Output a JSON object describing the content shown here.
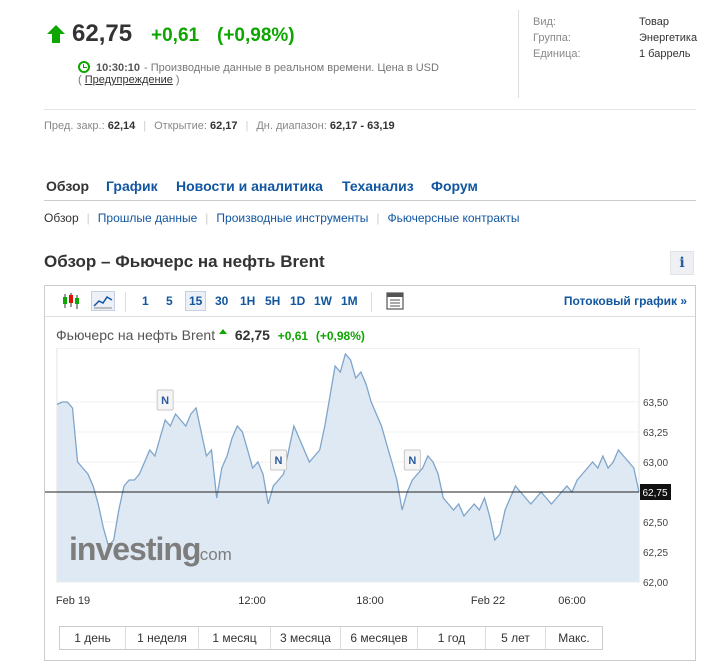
{
  "quote": {
    "price": "62,75",
    "change": "+0,61",
    "change_pct": "(+0,98%)",
    "time": "10:30:10",
    "time_note": "- Производные данные в реальном времени. Цена в USD",
    "disclaimer_open": "(",
    "disclaimer_link": "Предупреждение",
    "disclaimer_close": ")",
    "color_up": "#0ea600"
  },
  "info": {
    "rows": [
      {
        "label": "Вид:",
        "value": "Товар"
      },
      {
        "label": "Группа:",
        "value": "Энергетика"
      },
      {
        "label": "Единица:",
        "value": "1 баррель"
      }
    ]
  },
  "stats": {
    "prev_close_label": "Пред. закр.:",
    "prev_close": "62,14",
    "open_label": "Открытие:",
    "open": "62,17",
    "range_label": "Дн. диапазон:",
    "range": "62,17 - 63,19"
  },
  "nav": {
    "tabs": [
      "Обзор",
      "График",
      "Новости и аналитика",
      "Теханализ",
      "Форум"
    ],
    "subtabs": [
      "Обзор",
      "Прошлые данные",
      "Производные инструменты",
      "Фьючерсные контракты"
    ]
  },
  "section_title": "Обзор – Фьючерс на нефть Brent",
  "info_button": "i",
  "toolbar": {
    "intervals": [
      "1",
      "5",
      "15",
      "30",
      "1H",
      "5H",
      "1D",
      "1W",
      "1M"
    ],
    "active_interval": "15",
    "stream_label": "Потоковый график »"
  },
  "chart_header": {
    "name": "Фьючерс на нефть Brent",
    "price": "62,75",
    "change": "+0,61",
    "change_pct": "(+0,98%)"
  },
  "watermark": {
    "brand": "investing",
    "suffix": ".com"
  },
  "ranges": [
    "1 день",
    "1 неделя",
    "1 месяц",
    "3 месяца",
    "6 месяцев",
    "1 год",
    "5 лет",
    "Макс."
  ],
  "chart_data": {
    "type": "area",
    "title": "Фьючерс на нефть Brent",
    "x_ticks": [
      "Feb 19",
      "12:00",
      "18:00",
      "Feb 22",
      "06:00"
    ],
    "y_ticks": [
      "63,50",
      "63,25",
      "63,00",
      "62,50",
      "62,25",
      "62,00"
    ],
    "ylim": [
      62.0,
      63.95
    ],
    "current_price": 62.75,
    "current_label": "62,75",
    "news_markers": [
      "N",
      "N",
      "N"
    ],
    "series": [
      {
        "values": [
          63.48,
          63.5,
          63.5,
          63.45,
          63.0,
          62.95,
          62.9,
          62.8,
          62.65,
          62.45,
          62.3,
          62.35,
          62.6,
          62.8,
          62.85,
          62.85,
          62.9,
          63.0,
          63.1,
          63.05,
          63.2,
          63.35,
          63.3,
          63.4,
          63.35,
          63.3,
          63.4,
          63.45,
          63.25,
          63.05,
          63.1,
          62.7,
          62.95,
          63.05,
          63.2,
          63.3,
          63.25,
          63.1,
          62.95,
          63.0,
          62.9,
          62.65,
          62.8,
          62.85,
          62.9,
          63.1,
          63.3,
          63.2,
          63.1,
          63.0,
          63.05,
          63.1,
          63.3,
          63.55,
          63.8,
          63.75,
          63.9,
          63.85,
          63.7,
          63.75,
          63.65,
          63.5,
          63.4,
          63.3,
          63.15,
          63.0,
          62.85,
          62.6,
          62.75,
          62.85,
          62.9,
          62.95,
          63.05,
          63.0,
          62.9,
          62.7,
          62.65,
          62.6,
          62.65,
          62.55,
          62.6,
          62.65,
          62.6,
          62.7,
          62.55,
          62.35,
          62.4,
          62.6,
          62.7,
          62.8,
          62.75,
          62.7,
          62.65,
          62.7,
          62.75,
          62.7,
          62.65,
          62.7,
          62.75,
          62.8,
          62.75,
          62.85,
          62.9,
          62.95,
          63.0,
          62.95,
          63.05,
          62.95,
          63.0,
          63.1,
          63.05,
          63.0,
          62.95,
          62.75
        ]
      }
    ]
  }
}
